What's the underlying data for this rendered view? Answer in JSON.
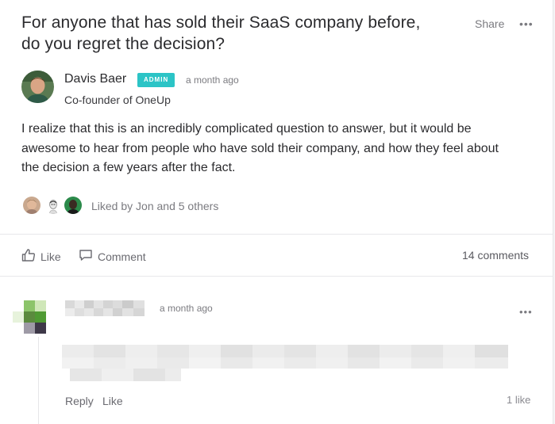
{
  "post": {
    "title_line1": "For anyone that has sold their SaaS company before,",
    "title_line2": "do you regret the decision?",
    "share_label": "Share",
    "more_label": "•••",
    "author": {
      "name": "Davis Baer",
      "badge": "ADMIN",
      "time": "a month ago",
      "role": "Co-founder of OneUp"
    },
    "body_lines": [
      "I realize that this is an incredibly complicated question to answer, but it would be",
      "awesome to hear from people who have sold their company, and how they feel about",
      "the decision a few years after the fact."
    ],
    "liked_by": "Liked by Jon and 5 others"
  },
  "actions": {
    "like_label": "Like",
    "comment_label": "Comment",
    "comments_count": "14 comments"
  },
  "comment": {
    "time": "a month ago",
    "more_label": "•••",
    "reply_label": "Reply",
    "like_label": "Like",
    "likes": "1 like"
  },
  "colors": {
    "accent": "#2cc4c6",
    "text": "#2b2b2e",
    "muted": "#7b7b80"
  }
}
